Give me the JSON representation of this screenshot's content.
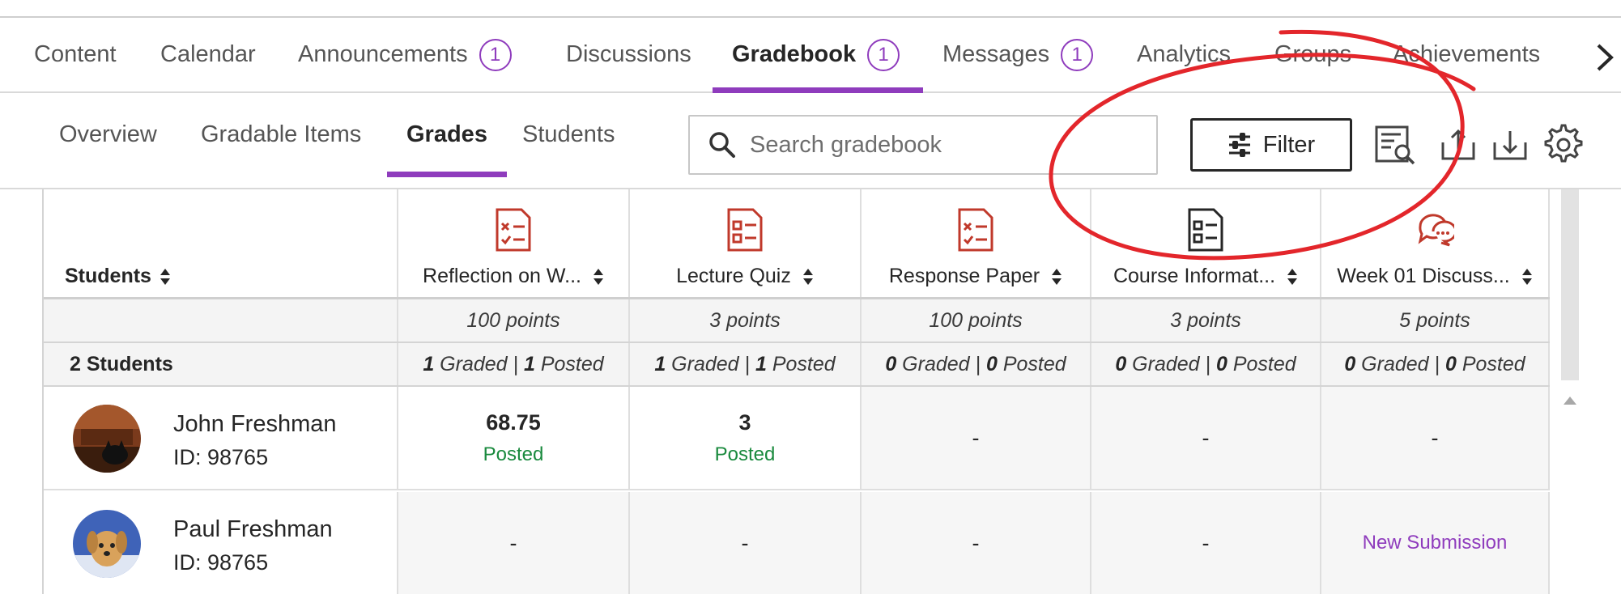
{
  "course_nav": {
    "tabs": [
      {
        "label": "Content"
      },
      {
        "label": "Calendar"
      },
      {
        "label": "Announcements",
        "badge": "1"
      },
      {
        "label": "Discussions"
      },
      {
        "label": "Gradebook",
        "badge": "1",
        "active": true
      },
      {
        "label": "Messages",
        "badge": "1"
      },
      {
        "label": "Analytics"
      },
      {
        "label": "Groups"
      },
      {
        "label": "Achievements"
      }
    ],
    "next_icon": "chevron-right-icon"
  },
  "sub_nav": {
    "tabs": [
      {
        "label": "Overview"
      },
      {
        "label": "Gradable Items"
      },
      {
        "label": "Grades",
        "active": true
      },
      {
        "label": "Students"
      }
    ]
  },
  "toolbar": {
    "search_placeholder": "Search gradebook",
    "filter_label": "Filter",
    "icons": [
      "search-document-icon",
      "upload-icon",
      "download-icon",
      "gear-icon"
    ]
  },
  "grid": {
    "students_header": "Students",
    "student_count": "2 Students",
    "columns": [
      {
        "title": "Reflection on W...",
        "icon": "assignment-icon",
        "points": "100 points",
        "graded": "1",
        "posted": "1"
      },
      {
        "title": "Lecture Quiz",
        "icon": "quiz-icon",
        "points": "3 points",
        "graded": "1",
        "posted": "1"
      },
      {
        "title": "Response Paper",
        "icon": "assignment-icon",
        "points": "100 points",
        "graded": "0",
        "posted": "0"
      },
      {
        "title": "Course Informat...",
        "icon": "document-icon",
        "points": "3 points",
        "graded": "0",
        "posted": "0"
      },
      {
        "title": "Week 01 Discuss...",
        "icon": "discussion-icon",
        "points": "5 points",
        "graded": "0",
        "posted": "0"
      }
    ],
    "graded_word": "Graded",
    "posted_word": "Posted",
    "separator": "|",
    "rows": [
      {
        "name": "John Freshman",
        "id": "ID: 98765",
        "cells": [
          {
            "value": "68.75",
            "status": "Posted"
          },
          {
            "value": "3",
            "status": "Posted"
          },
          {
            "value": "-"
          },
          {
            "value": "-"
          },
          {
            "value": "-"
          }
        ]
      },
      {
        "name": "Paul Freshman",
        "id": "ID: 98765",
        "cells": [
          {
            "value": "-"
          },
          {
            "value": "-"
          },
          {
            "value": "-"
          },
          {
            "value": "-"
          },
          {
            "value": "",
            "status_link": "New Submission"
          }
        ]
      }
    ]
  },
  "colors": {
    "accent": "#8f3cbd",
    "posted_green": "#1a8a3e",
    "icon_red": "#c0392b",
    "annotation_red": "#e3262b"
  }
}
